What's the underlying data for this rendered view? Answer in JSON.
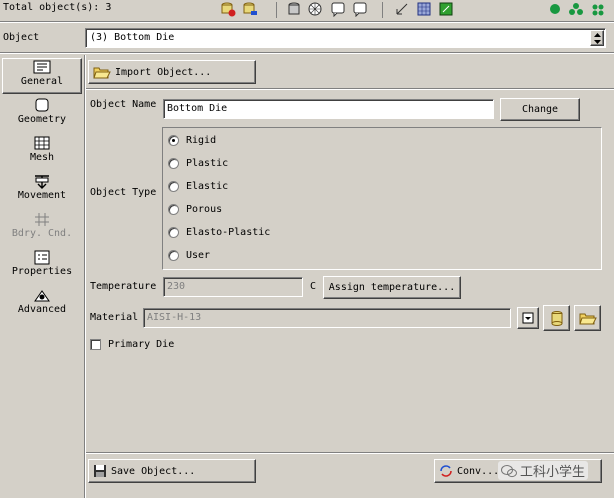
{
  "toolbar": {
    "total_objects_label": "Total object(s): 3",
    "icons": [
      "add-object-icon",
      "delete-object-icon",
      "database-icon",
      "mesh-icon",
      "window-icon",
      "window2-icon",
      "axis-icon",
      "grid-icon",
      "shade-icon",
      "green-dot-icon",
      "cluster-icon",
      "blue-dot-icon"
    ]
  },
  "object_select": {
    "label": "Object",
    "value": "(3) Bottom Die"
  },
  "sidebar": {
    "items": [
      {
        "label": "General",
        "icon": "general-icon",
        "active": true
      },
      {
        "label": "Geometry",
        "icon": "geometry-icon"
      },
      {
        "label": "Mesh",
        "icon": "mesh-icon"
      },
      {
        "label": "Movement",
        "icon": "movement-icon"
      },
      {
        "label": "Bdry. Cnd.",
        "icon": "boundary-icon",
        "disabled": true
      },
      {
        "label": "Properties",
        "icon": "properties-icon"
      },
      {
        "label": "Advanced",
        "icon": "advanced-icon"
      }
    ]
  },
  "general": {
    "import_label": "Import Object...",
    "object_name_label": "Object Name",
    "object_name_value": "Bottom Die",
    "change_label": "Change",
    "object_type_label": "Object Type",
    "types": [
      {
        "label": "Rigid",
        "selected": true
      },
      {
        "label": "Plastic"
      },
      {
        "label": "Elastic"
      },
      {
        "label": "Porous"
      },
      {
        "label": "Elasto-Plastic"
      },
      {
        "label": "User"
      }
    ],
    "temperature_label": "Temperature",
    "temperature_value": "230",
    "temperature_unit": "C",
    "assign_temp_label": "Assign temperature...",
    "material_label": "Material",
    "material_value": "AISI-H-13",
    "primary_die_label": "Primary Die",
    "primary_die_checked": false,
    "save_label": "Save Object...",
    "convert_label": "Conv..."
  },
  "watermark": "工科小学生",
  "colors": {
    "face": "#d4d0c8",
    "disabled_text": "#808080"
  }
}
